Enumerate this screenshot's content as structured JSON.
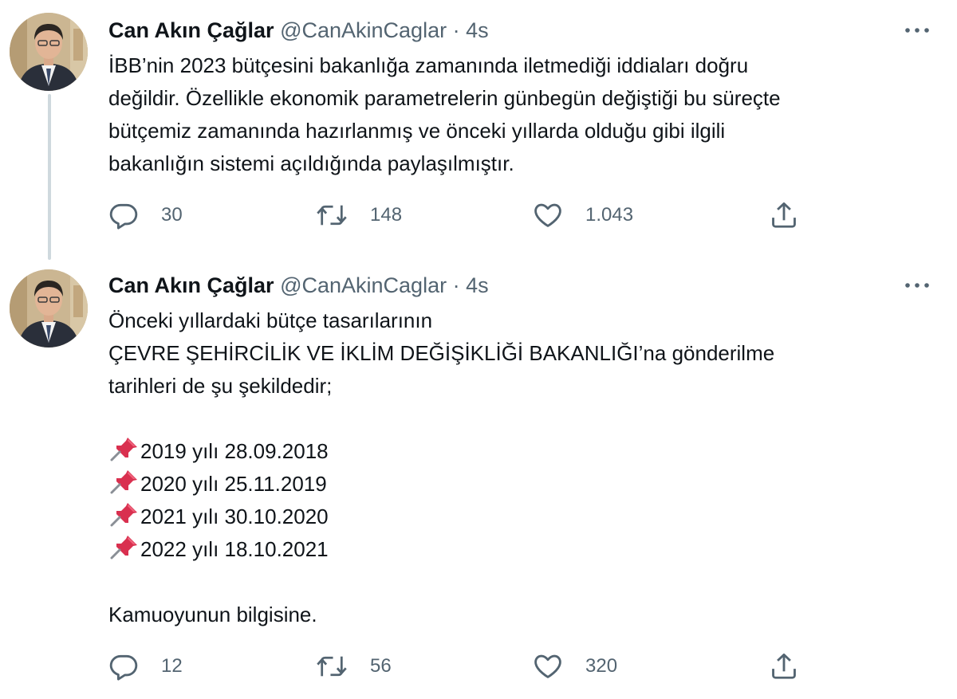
{
  "tweets": [
    {
      "author": {
        "name": "Can Akın Çağlar",
        "handle": "@CanAkinCaglar",
        "separator": "·",
        "time": "4s"
      },
      "lines": [
        "İBB’nin 2023 bütçesini bakanlığa zamanında iletmediği iddiaları doğru",
        "değildir. Özellikle ekonomik parametrelerin günbegün değiştiği bu süreçte",
        "bütçemiz zamanında hazırlanmış ve önceki yıllarda olduğu gibi ilgili",
        "bakanlığın sistemi açıldığında paylaşılmıştır."
      ],
      "stats": {
        "replies": "30",
        "retweets": "148",
        "likes": "1.043"
      }
    },
    {
      "author": {
        "name": "Can Akın Çağlar",
        "handle": "@CanAkinCaglar",
        "separator": "·",
        "time": "4s"
      },
      "intro": [
        "Önceki yıllardaki bütçe tasarılarının",
        "ÇEVRE ŞEHİRCİLİK VE İKLİM DEĞİŞİKLİĞİ BAKANLIĞI’na gönderilme",
        "tarihleri de şu şekildedir;"
      ],
      "dates": [
        "2019 yılı 28.09.2018",
        "2020 yılı 25.11.2019",
        "2021 yılı 30.10.2020",
        "2022 yılı 18.10.2021"
      ],
      "closing": "Kamuoyunun bilgisine.",
      "stats": {
        "replies": "12",
        "retweets": "56",
        "likes": "320"
      }
    }
  ],
  "icons": {
    "reply": "reply-icon",
    "retweet": "retweet-icon",
    "like": "like-icon",
    "share": "share-icon",
    "more": "more-icon",
    "pin": "pushpin-icon"
  },
  "colors": {
    "text": "#0f1419",
    "secondary": "#536471",
    "thread_line": "#cfd9de",
    "pin": "#d9304f"
  }
}
